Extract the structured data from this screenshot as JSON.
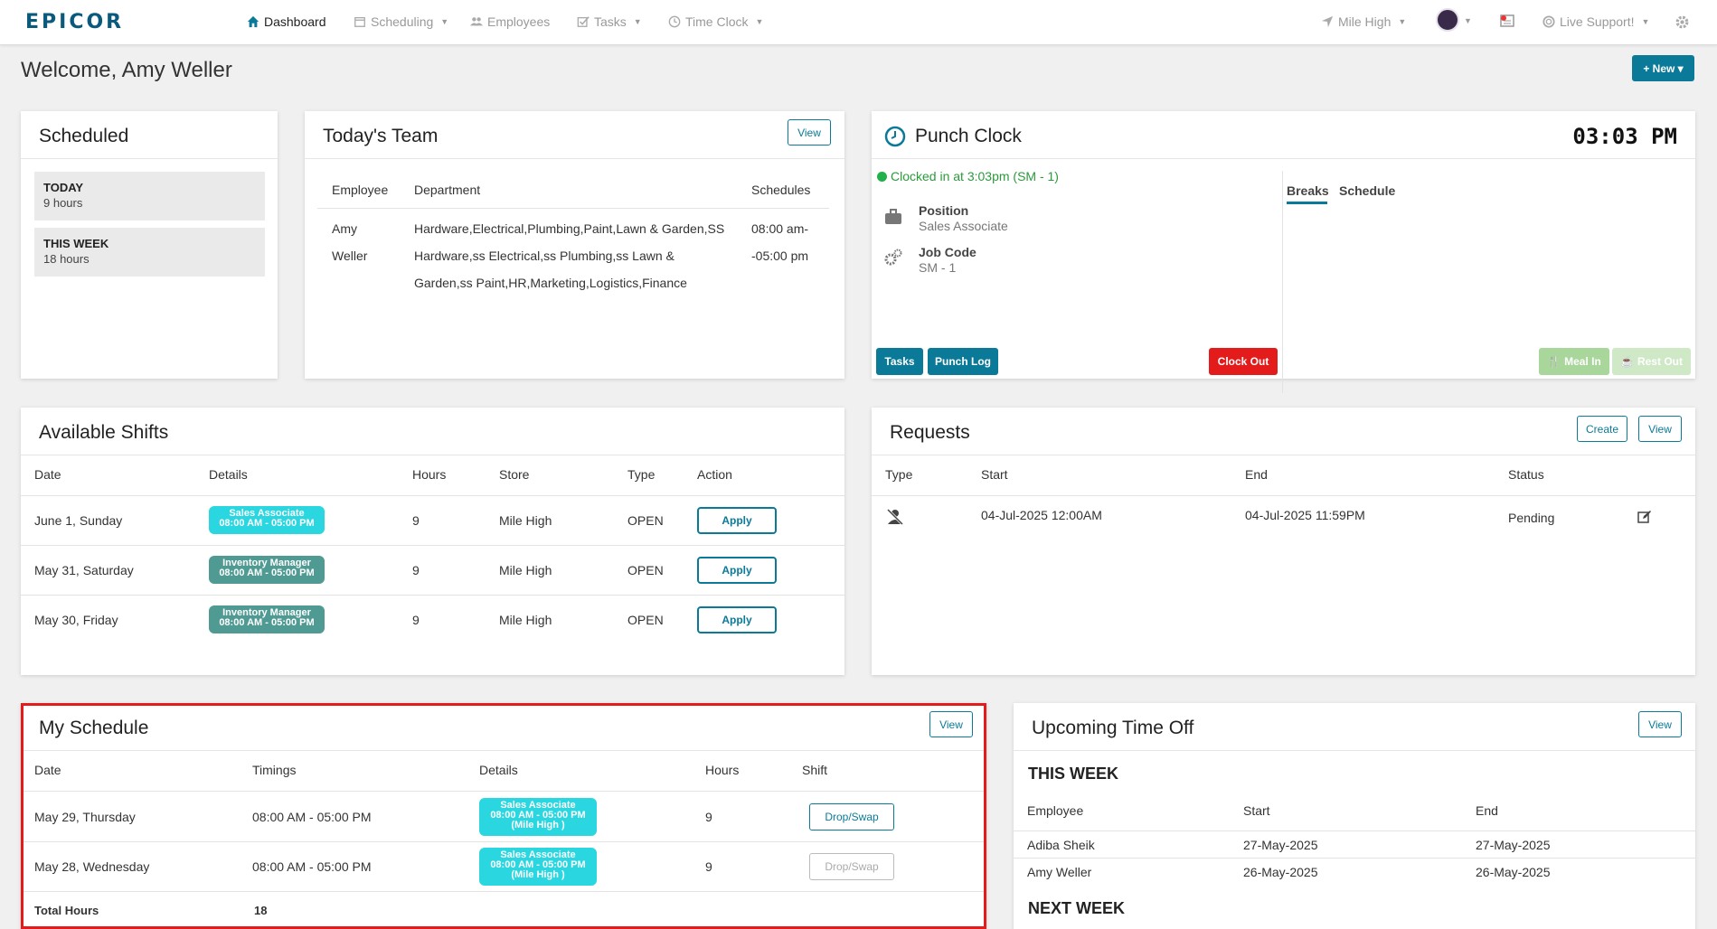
{
  "brand": {
    "logo": "EPICOR",
    "accent": "#0b7a99"
  },
  "nav": {
    "dashboard": "Dashboard",
    "scheduling": "Scheduling",
    "employees": "Employees",
    "tasks": "Tasks",
    "time_clock": "Time Clock",
    "store": "Mile High",
    "support": "Live Support!"
  },
  "header": {
    "welcome": "Welcome, Amy Weller",
    "new_button": "+ New ▾"
  },
  "scheduled": {
    "title": "Scheduled",
    "today_label": "TODAY",
    "today_value": "9 hours",
    "week_label": "THIS WEEK",
    "week_value": "18 hours"
  },
  "team": {
    "title": "Today's Team",
    "view": "View",
    "columns": [
      "Employee",
      "Department",
      "Schedules"
    ],
    "row": {
      "employee_1": "Amy",
      "employee_2": "Weller",
      "dept_1": "Hardware,Electrical,Plumbing,Paint,Lawn & Garden,SS",
      "dept_2": "Hardware,ss Electrical,ss Plumbing,ss Lawn &",
      "dept_3": "Garden,ss Paint,HR,Marketing,Logistics,Finance",
      "sched_1": "08:00 am-",
      "sched_2": "-05:00 pm"
    }
  },
  "punch": {
    "title": "Punch Clock",
    "time": "03:03 PM",
    "status": "Clocked in at 3:03pm (SM - 1)",
    "position_label": "Position",
    "position_value": "Sales Associate",
    "job_label": "Job Code",
    "job_value": "SM - 1",
    "tab_breaks": "Breaks",
    "tab_schedule": "Schedule",
    "tasks_btn": "Tasks",
    "punchlog_btn": "Punch Log",
    "clockout_btn": "Clock Out",
    "mealin_btn": "Meal In",
    "restout_btn": "Rest Out"
  },
  "shifts": {
    "title": "Available Shifts",
    "columns": [
      "Date",
      "Details",
      "Hours",
      "Store",
      "Type",
      "Action"
    ],
    "rows": [
      {
        "date": "June 1, Sunday",
        "role": "Sales Associate",
        "time": "08:00 AM - 05:00 PM",
        "hours": "9",
        "store": "Mile High",
        "type": "OPEN",
        "action": "Apply"
      },
      {
        "date": "May 31, Saturday",
        "role": "Inventory Manager",
        "time": "08:00 AM - 05:00 PM",
        "hours": "9",
        "store": "Mile High",
        "type": "OPEN",
        "action": "Apply"
      },
      {
        "date": "May 30, Friday",
        "role": "Inventory Manager",
        "time": "08:00 AM - 05:00 PM",
        "hours": "9",
        "store": "Mile High",
        "type": "OPEN",
        "action": "Apply"
      }
    ]
  },
  "requests": {
    "title": "Requests",
    "create": "Create",
    "view": "View",
    "columns": [
      "Type",
      "Start",
      "End",
      "Status"
    ],
    "row": {
      "start": "04-Jul-2025 12:00AM",
      "end": "04-Jul-2025 11:59PM",
      "status": "Pending"
    }
  },
  "my_schedule": {
    "title": "My Schedule",
    "view": "View",
    "columns": [
      "Date",
      "Timings",
      "Details",
      "Hours",
      "Shift"
    ],
    "rows": [
      {
        "date": "May 29, Thursday",
        "timing": "08:00 AM - 05:00 PM",
        "role": "Sales Associate",
        "time": "08:00 AM - 05:00 PM",
        "store": "(Mile High )",
        "hours": "9",
        "shift": "Drop/Swap"
      },
      {
        "date": "May 28, Wednesday",
        "timing": "08:00 AM - 05:00 PM",
        "role": "Sales Associate",
        "time": "08:00 AM - 05:00 PM",
        "store": "(Mile High )",
        "hours": "9",
        "shift": "Drop/Swap"
      }
    ],
    "total_label": "Total Hours",
    "total_value": "18"
  },
  "time_off": {
    "title": "Upcoming Time Off",
    "view": "View",
    "this_week": "THIS WEEK",
    "columns": [
      "Employee",
      "Start",
      "End"
    ],
    "rows": [
      {
        "employee": "Adiba Sheik",
        "start": "27-May-2025",
        "end": "27-May-2025"
      },
      {
        "employee": "Amy Weller",
        "start": "26-May-2025",
        "end": "26-May-2025"
      }
    ],
    "next_week": "NEXT WEEK"
  }
}
